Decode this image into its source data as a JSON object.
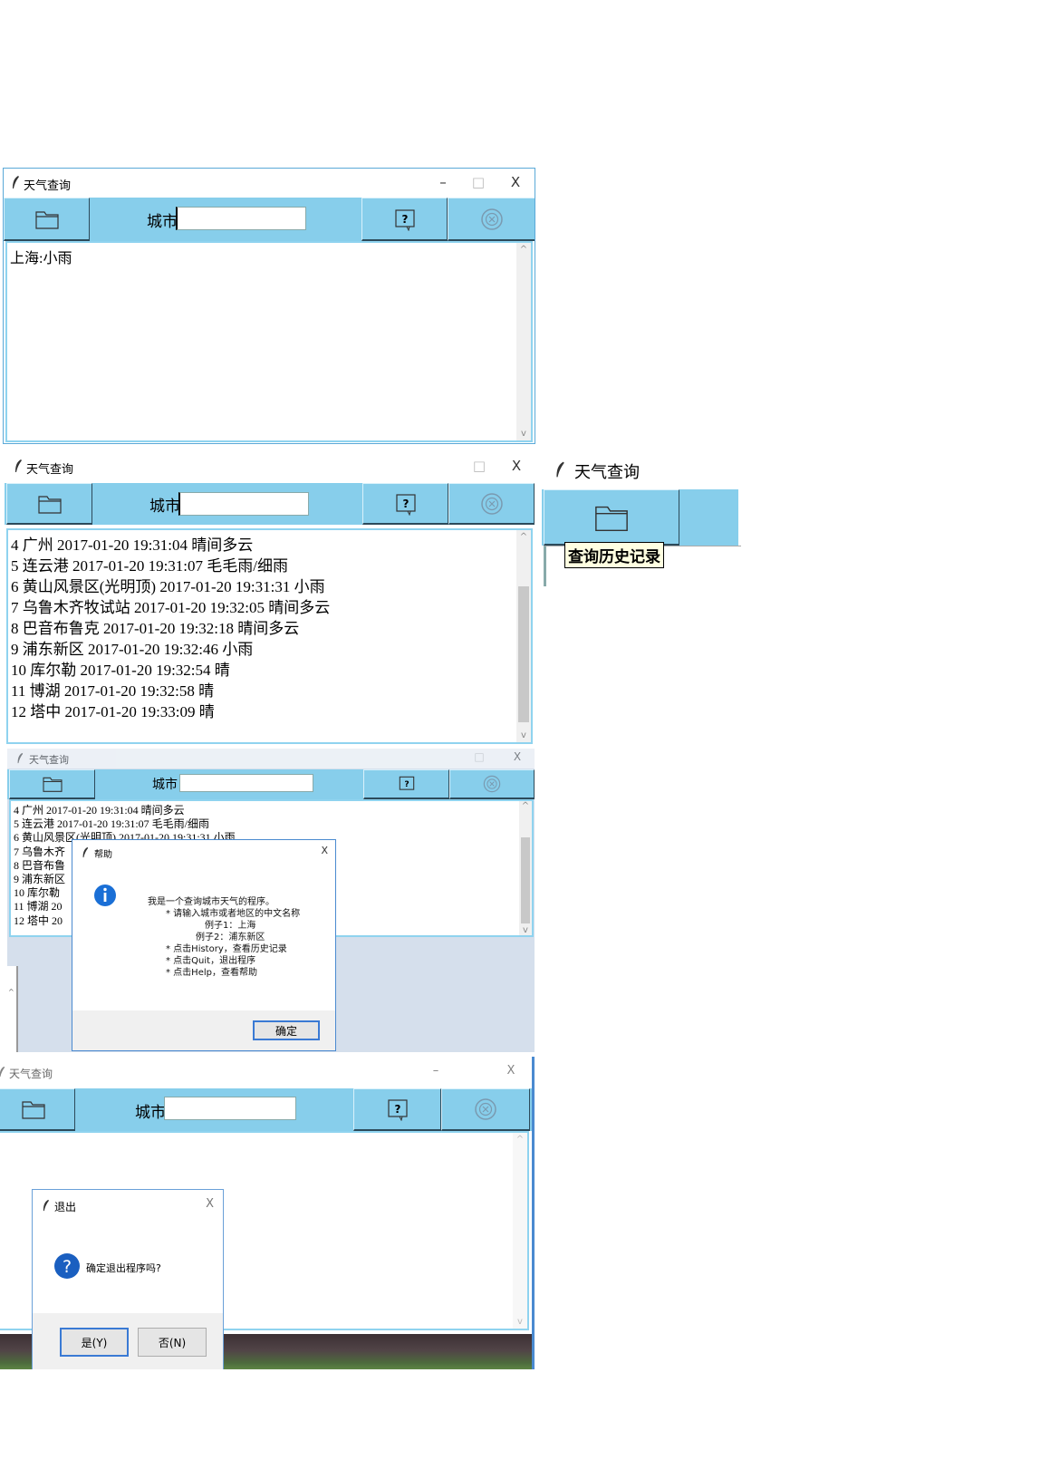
{
  "app": {
    "title": "天气查询",
    "city_label": "城市"
  },
  "window_controls": {
    "minimize": "–",
    "maximize": "□",
    "close": "X"
  },
  "panel1": {
    "result": "上海:小雨"
  },
  "history": [
    "4 广州 2017-01-20 19:31:04 晴间多云",
    "5 连云港 2017-01-20 19:31:07 毛毛雨/细雨",
    "6 黄山风景区(光明顶) 2017-01-20 19:31:31 小雨",
    "7 乌鲁木齐牧试站 2017-01-20 19:32:05 晴间多云",
    "8 巴音布鲁克 2017-01-20 19:32:18 晴间多云",
    "9 浦东新区 2017-01-20 19:32:46 小雨",
    "10 库尔勒 2017-01-20 19:32:54 晴",
    "11 博湖 2017-01-20 19:32:58 晴",
    "12 塔中 2017-01-20 19:33:09 晴"
  ],
  "history_overlap": [
    "4 广州 2017-01-20 19:31:04 晴间多云",
    "5 连云港 2017-01-20 19:31:07 毛毛雨/细雨",
    "6 黄山风景区(光明顶) 2017-01-20 19:31:31 小雨",
    "7 乌鲁木齐",
    "8 巴音布鲁",
    "9 浦东新区",
    "10 库尔勒",
    "11 博湖 20",
    "12 塔中 20"
  ],
  "tooltip": {
    "text": "查询历史记录"
  },
  "help_dialog": {
    "title": "帮助",
    "lines": [
      "我是一个查询城市天气的程序。",
      "* 请输入城市或者地区的中文名称",
      "例子1：上海",
      "例子2：浦东新区",
      "* 点击History，查看历史记录",
      "* 点击Quit，退出程序",
      "* 点击Help，查看帮助"
    ],
    "ok": "确定"
  },
  "quit_dialog": {
    "title": "退出",
    "message": "确定退出程序吗?",
    "yes": "是(Y)",
    "no": "否(N)"
  },
  "colors": {
    "toolbar": "#87ceeb",
    "accent": "#3a7ad4"
  }
}
